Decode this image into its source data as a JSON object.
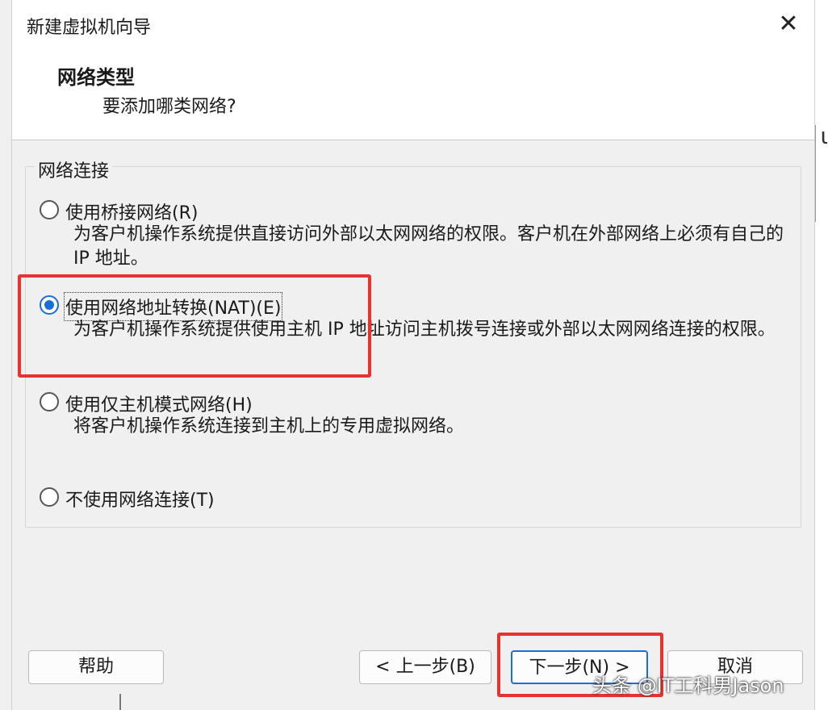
{
  "window": {
    "title": "新建虚拟机向导",
    "close_icon": "close-icon"
  },
  "header": {
    "title": "网络类型",
    "subtitle": "要添加哪类网络?"
  },
  "group": {
    "label": "网络连接",
    "options": [
      {
        "label": "使用桥接网络(R)",
        "desc": "为客户机操作系统提供直接访问外部以太网网络的权限。客户机在外部网络上必须有自己的 IP 地址。",
        "selected": false
      },
      {
        "label": "使用网络地址转换(NAT)(E)",
        "desc": "为客户机操作系统提供使用主机 IP 地址访问主机拨号连接或外部以太网网络连接的权限。",
        "selected": true
      },
      {
        "label": "使用仅主机模式网络(H)",
        "desc": "将客户机操作系统连接到主机上的专用虚拟网络。",
        "selected": false
      },
      {
        "label": "不使用网络连接(T)",
        "desc": "",
        "selected": false
      }
    ]
  },
  "buttons": {
    "help": "帮助",
    "back": "< 上一步(B)",
    "next": "下一步(N) >",
    "cancel": "取消"
  },
  "watermark": "头条 @IT工科男Jason",
  "colors": {
    "accent": "#1a6fd6",
    "annotation": "#e53333"
  }
}
